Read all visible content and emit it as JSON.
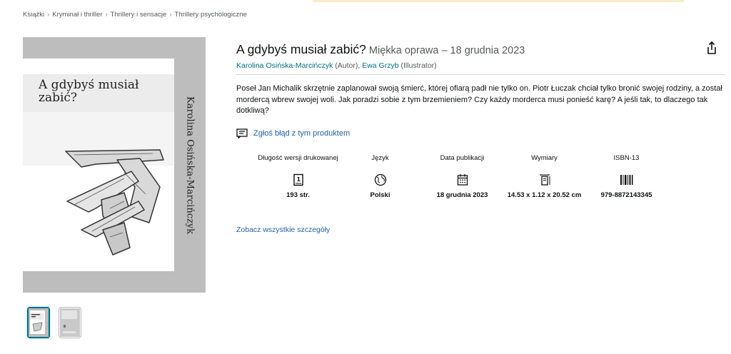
{
  "breadcrumb": [
    "Książki",
    "Kryminał i thriller",
    "Thrillery i sensacje",
    "Thrillery psychologiczne"
  ],
  "cover": {
    "title": "A gdybyś musiał zabić?",
    "author_spine": "Karolina Osińska-Marcińczyk"
  },
  "product": {
    "title": "A gdybyś musiał zabić?",
    "format": "Miękka oprawa – 18 grudnia 2023",
    "author_name": "Karolina Osińska-Marcińczyk",
    "author_role": " (Autor), ",
    "illustrator_name": "Ewa Grzyb",
    "illustrator_role": " (Illustrator)",
    "description": "Poseł Jan Michalik skrzętnie zaplanował swoją śmierć, której ofiarą padł nie tylko on. Piotr Łuczak chciał tylko bronić swojej rodziny, a został mordercą wbrew swojej woli. Jak poradzi sobie z tym brzemieniem? Czy każdy morderca musi ponieść karę? A jeśli tak, to dlaczego tak dotkliwą?",
    "report_label": "Zgłoś błąd z tym produktem",
    "see_all_label": "Zobacz wszystkie szczegóły"
  },
  "attributes": [
    {
      "label": "Długość wersji drukowanej",
      "icon": "book-pages-icon",
      "value": "193 str."
    },
    {
      "label": "Język",
      "icon": "globe-icon",
      "value": "Polski"
    },
    {
      "label": "Data publikacji",
      "icon": "calendar-icon",
      "value": "18 grudnia 2023"
    },
    {
      "label": "Wymiary",
      "icon": "dimensions-icon",
      "value": "14.53 x 1.12 x 20.52 cm"
    },
    {
      "label": "ISBN-13",
      "icon": "barcode-icon",
      "value": "979-8872143345"
    }
  ],
  "colors": {
    "link": "#007185",
    "link_alt": "#2162a1",
    "text": "#0f1111",
    "muted": "#565959",
    "thumb_selected": "#007185"
  }
}
